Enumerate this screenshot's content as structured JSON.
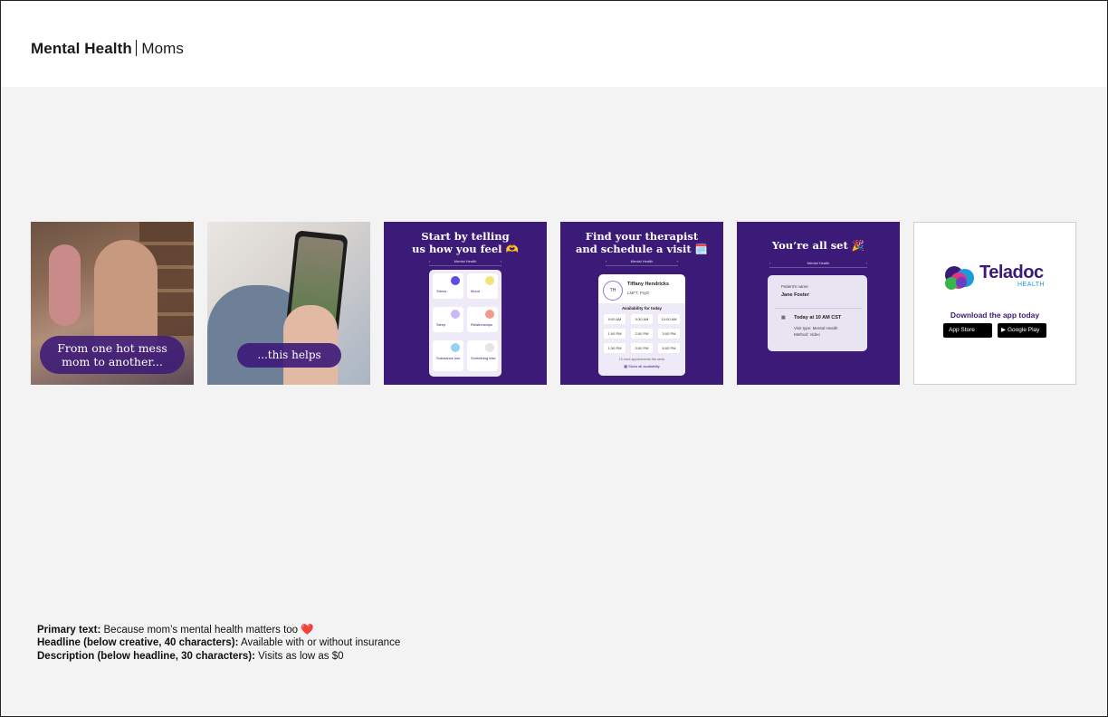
{
  "header": {
    "title_bold": "Mental Health",
    "title_rest": "Moms"
  },
  "tiles": {
    "t1": {
      "caption_line1": "From one hot mess",
      "caption_line2": "mom to another..."
    },
    "t2": {
      "caption": "...this helps"
    },
    "t3": {
      "headline_line1": "Start by telling",
      "headline_line2": "us how you feel 🫶",
      "nav_title": "Mental Health",
      "options": [
        "Stress",
        "Mood",
        "Sleep",
        "Relationships",
        "Substance use",
        "Something else"
      ]
    },
    "t4": {
      "headline_line1": "Find your therapist",
      "headline_line2": "and schedule a visit 🗓️",
      "nav_title": "Mental Health",
      "initials": "TH",
      "therapist_name": "Tiffany Hendricks",
      "therapist_credentials": "LMFT, PsyD",
      "availability_label": "Availability for today",
      "slots": [
        "9:00 AM",
        "9:30 AM",
        "10:00 AM",
        "1:00 PM",
        "2:00 PM",
        "3:00 PM",
        "1:30 PM",
        "3:00 PM",
        "6:00 PM"
      ],
      "more_note": "10 more appointments this week",
      "show_all": "Show all availability"
    },
    "t5": {
      "headline": "You’re all set 🎉",
      "nav_title": "Mental Health",
      "patient_label": "Patient’s name",
      "patient_name": "Jane Foster",
      "appointment": "Today at 10 AM CST",
      "visit_type": "Visit type: Mental Health",
      "method": "Method: Video"
    },
    "t6": {
      "brand": "Teladoc",
      "brand_sub": "HEALTH",
      "download": "Download the app today",
      "app_store": "App Store",
      "google_play": "Google Play"
    }
  },
  "copy": {
    "primary_label": "Primary text:",
    "primary_value": "Because mom’s mental health matters too ❤️",
    "headline_label": "Headline (below creative, 40 characters):",
    "headline_value": "Available with or without insurance",
    "description_label": "Description (below headline, 30 characters):",
    "description_value": "Visits as low as $0"
  },
  "colors": {
    "brand_purple": "#3c1a78",
    "canvas": "#f3f3f3",
    "accent_blue": "#1a9ad6"
  }
}
